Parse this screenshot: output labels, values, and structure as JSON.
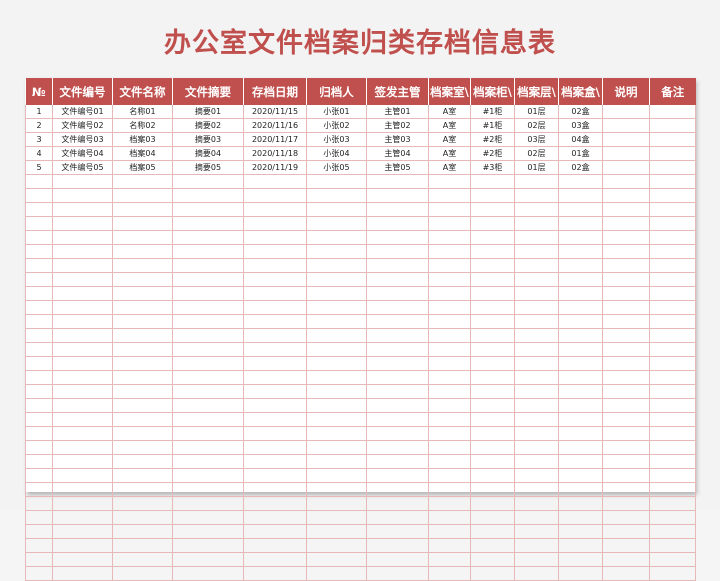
{
  "title": "办公室文件档案归类存档信息表",
  "headers": [
    "№",
    "文件编号",
    "文件名称",
    "文件摘要",
    "存档日期",
    "归档人",
    "签发主管",
    "档案室\\",
    "档案柜\\",
    "档案层\\",
    "档案盒\\",
    "说明",
    "备注"
  ],
  "rows": [
    [
      "1",
      "文件编号01",
      "名称01",
      "摘要01",
      "2020/11/15",
      "小张01",
      "主管01",
      "A室",
      "#1柜",
      "01层",
      "02盒",
      "",
      ""
    ],
    [
      "2",
      "文件编号02",
      "名称02",
      "摘要02",
      "2020/11/16",
      "小张02",
      "主管02",
      "A室",
      "#1柜",
      "02层",
      "03盒",
      "",
      ""
    ],
    [
      "3",
      "文件编号03",
      "档案03",
      "摘要03",
      "2020/11/17",
      "小张03",
      "主管03",
      "A室",
      "#2柜",
      "03层",
      "04盒",
      "",
      ""
    ],
    [
      "4",
      "文件编号04",
      "档案04",
      "摘要04",
      "2020/11/18",
      "小张04",
      "主管04",
      "A室",
      "#2柜",
      "02层",
      "01盒",
      "",
      ""
    ],
    [
      "5",
      "文件编号05",
      "档案05",
      "摘要05",
      "2020/11/19",
      "小张05",
      "主管05",
      "A室",
      "#3柜",
      "01层",
      "02盒",
      "",
      ""
    ]
  ],
  "empty_row_count": 29,
  "colors": {
    "header_bg": "#c0504d",
    "title": "#c0504d",
    "grid": "#e6b9b8"
  }
}
